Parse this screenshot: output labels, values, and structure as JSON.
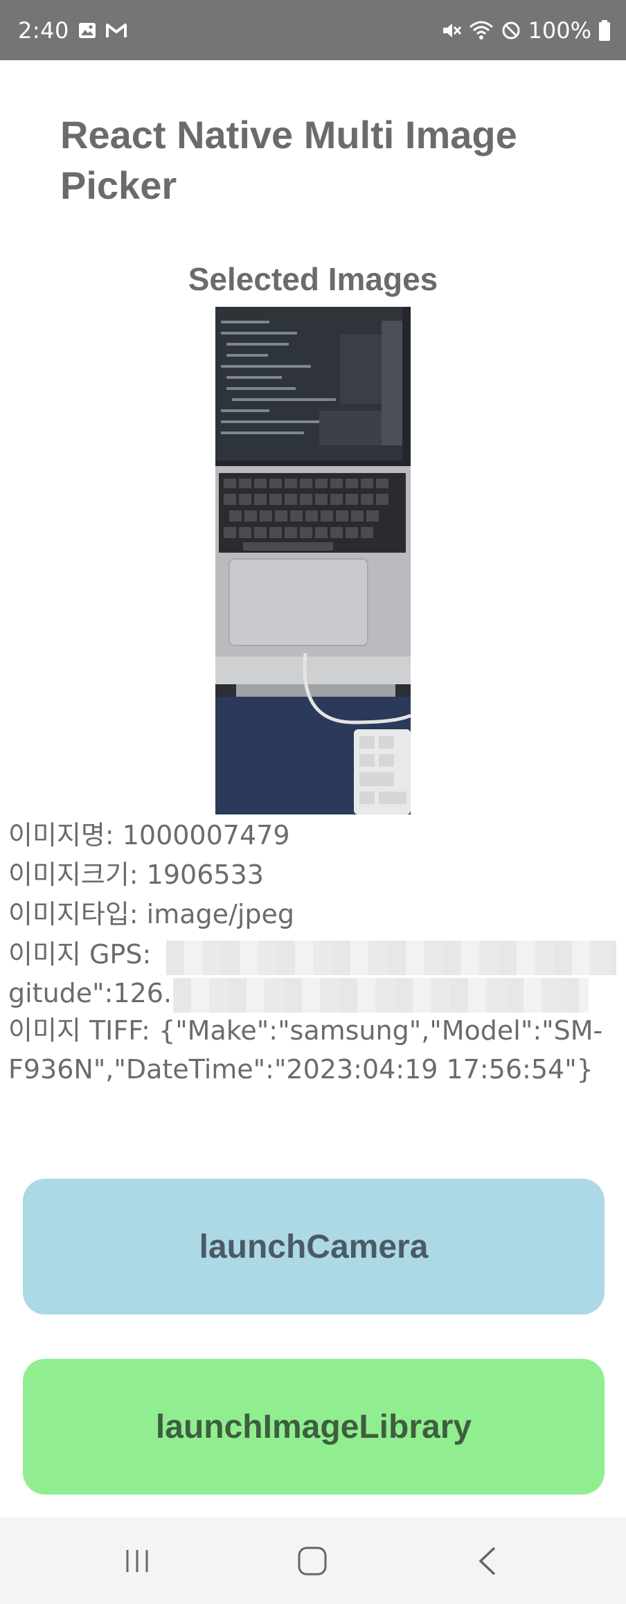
{
  "status_bar": {
    "time": "2:40",
    "battery": "100%",
    "icons": [
      "image-icon",
      "gmail-icon",
      "mute-icon",
      "wifi-icon",
      "dnd-icon",
      "battery-icon"
    ]
  },
  "app": {
    "title": "React Native Multi Image Picker",
    "section_title": "Selected Images"
  },
  "image_info": {
    "name": "이미지명: 1000007479",
    "size": "이미지크기: 1906533",
    "type": "이미지타입: image/jpeg",
    "gps_prefix": "이미지 GPS:",
    "gps_line2": "gitude\":126.",
    "tiff": "이미지 TIFF: {\"Make\":\"samsung\",\"Model\":\"SM-F936N\",\"DateTime\":\"2023:04:19 17:56:54\"}"
  },
  "buttons": {
    "camera": "launchCamera",
    "library": "launchImageLibrary"
  },
  "colors": {
    "status_bar": "#757575",
    "camera_button": "#add8e6",
    "library_button": "#90ee90",
    "text": "#6b6b6b"
  }
}
